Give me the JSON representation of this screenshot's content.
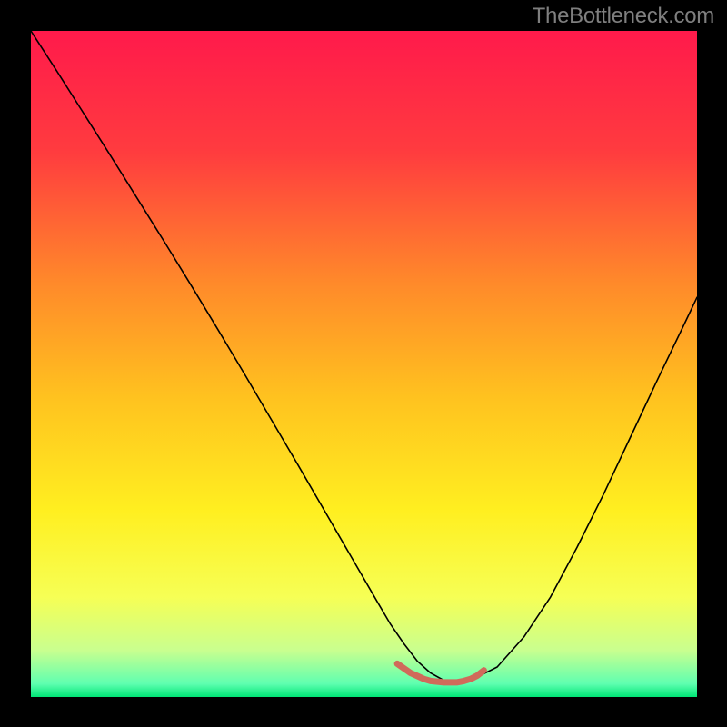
{
  "watermark": "TheBottleneck.com",
  "chart_data": {
    "type": "line",
    "title": "",
    "xlabel": "",
    "ylabel": "",
    "xlim": [
      0,
      100
    ],
    "ylim": [
      0,
      100
    ],
    "axes_visible": false,
    "gradient_stops": [
      {
        "offset": 0.0,
        "color": "#ff1a4b"
      },
      {
        "offset": 0.18,
        "color": "#ff3b3f"
      },
      {
        "offset": 0.38,
        "color": "#ff8a2a"
      },
      {
        "offset": 0.55,
        "color": "#ffc21f"
      },
      {
        "offset": 0.72,
        "color": "#ffef20"
      },
      {
        "offset": 0.85,
        "color": "#f6ff55"
      },
      {
        "offset": 0.93,
        "color": "#c9ff8f"
      },
      {
        "offset": 0.98,
        "color": "#5fffb0"
      },
      {
        "offset": 1.0,
        "color": "#00e676"
      }
    ],
    "series": [
      {
        "name": "curve",
        "color": "#000000",
        "width": 1.6,
        "x": [
          0,
          4,
          8,
          12,
          16,
          20,
          24,
          28,
          32,
          36,
          40,
          44,
          48,
          52,
          54,
          56,
          58,
          60,
          62,
          64,
          66,
          70,
          74,
          78,
          82,
          86,
          90,
          94,
          98,
          100
        ],
        "y": [
          100,
          93.8,
          87.5,
          81.2,
          74.8,
          68.4,
          61.9,
          55.3,
          48.6,
          41.8,
          35.0,
          28.1,
          21.2,
          14.3,
          10.9,
          8.0,
          5.4,
          3.6,
          2.5,
          2.2,
          2.5,
          4.5,
          9.0,
          15.0,
          22.5,
          30.5,
          39.0,
          47.5,
          55.8,
          60.0
        ]
      },
      {
        "name": "trough-marker",
        "color": "#d06a5a",
        "width": 7,
        "x": [
          55,
          57,
          59,
          60,
          61,
          62,
          63,
          64,
          65,
          66,
          67,
          68
        ],
        "y": [
          5.0,
          3.6,
          2.7,
          2.4,
          2.3,
          2.2,
          2.2,
          2.2,
          2.4,
          2.7,
          3.2,
          4.0
        ]
      }
    ]
  }
}
